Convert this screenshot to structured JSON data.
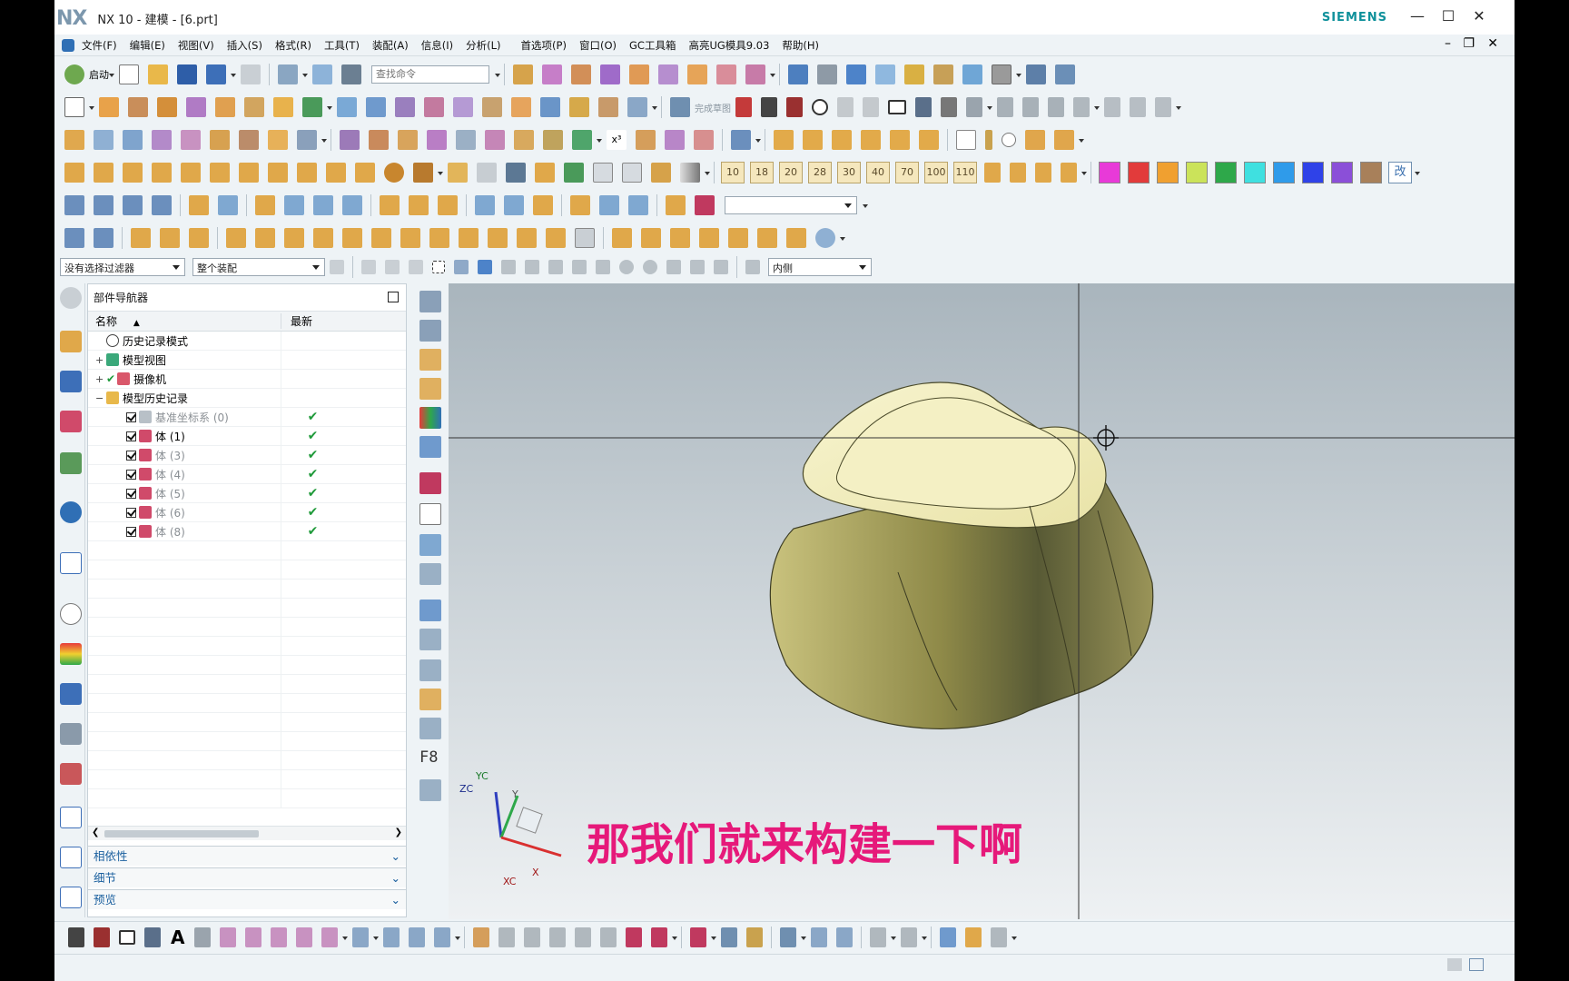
{
  "window": {
    "app_logo": "NX",
    "title": "NX 10 - 建模 - [6.prt]",
    "brand": "SIEMENS",
    "brand_color": "#10919b",
    "controls": [
      "minimize-icon",
      "maximize-icon",
      "close-icon"
    ]
  },
  "menubar": {
    "items": [
      "文件(F)",
      "编辑(E)",
      "视图(V)",
      "插入(S)",
      "格式(R)",
      "工具(T)",
      "装配(A)",
      "信息(I)",
      "分析(L)",
      "首选项(P)",
      "窗口(O)",
      "GC工具箱",
      "高亮UG模具9.03",
      "帮助(H)"
    ]
  },
  "toolbar": {
    "start_label": "启动",
    "search_placeholder": "查找命令",
    "finish_sketch_label": "完成草图",
    "number_buttons": [
      "10",
      "18",
      "20",
      "28",
      "30",
      "40",
      "70",
      "100",
      "110"
    ],
    "palette": [
      "#e83ad8",
      "#e23b3b",
      "#f0a030",
      "#cbe35a",
      "#2ea84a",
      "#3fe0e0",
      "#2f9bea",
      "#2f42e8",
      "#8b4fd8",
      "#a8805a"
    ],
    "palette_change_label": "改",
    "selection_filter": "没有选择过滤器",
    "selection_scope": "整个装配",
    "inside_option": "内侧"
  },
  "navigator": {
    "title": "部件导航器",
    "columns": {
      "name": "名称",
      "newest": "最新"
    },
    "rows": [
      {
        "label": "历史记录模式",
        "level": 1,
        "icon": "clock-icon",
        "newest": ""
      },
      {
        "label": "模型视图",
        "level": 1,
        "icon": "model-views-icon",
        "newest": "",
        "expandable": true
      },
      {
        "label": "摄像机",
        "level": 1,
        "icon": "camera-icon",
        "newest": "",
        "expandable": true
      },
      {
        "label": "模型历史记录",
        "level": 1,
        "icon": "folder-icon",
        "newest": "",
        "expanded": true
      },
      {
        "label": "基准坐标系 (0)",
        "level": 2,
        "icon": "datum-csys-icon",
        "newest": "✔",
        "dim": true
      },
      {
        "label": "体 (1)",
        "level": 2,
        "icon": "body-icon",
        "newest": "✔"
      },
      {
        "label": "体 (3)",
        "level": 2,
        "icon": "body-icon",
        "newest": "✔",
        "dim": true
      },
      {
        "label": "体 (4)",
        "level": 2,
        "icon": "body-icon",
        "newest": "✔",
        "dim": true
      },
      {
        "label": "体 (5)",
        "level": 2,
        "icon": "body-icon",
        "newest": "✔",
        "dim": true
      },
      {
        "label": "体 (6)",
        "level": 2,
        "icon": "body-icon",
        "newest": "✔",
        "dim": true
      },
      {
        "label": "体 (8)",
        "level": 2,
        "icon": "body-icon",
        "newest": "✔",
        "dim": true
      }
    ],
    "panels": [
      "相依性",
      "细节",
      "预览"
    ]
  },
  "viewport": {
    "caption": "那我们就来构建一下啊",
    "caption_color": "#e6197a",
    "triad_labels": {
      "zc": "ZC",
      "yc": "YC",
      "y": "Y",
      "xc": "XC",
      "x": "X"
    },
    "vtoolbar_label": "F8"
  }
}
